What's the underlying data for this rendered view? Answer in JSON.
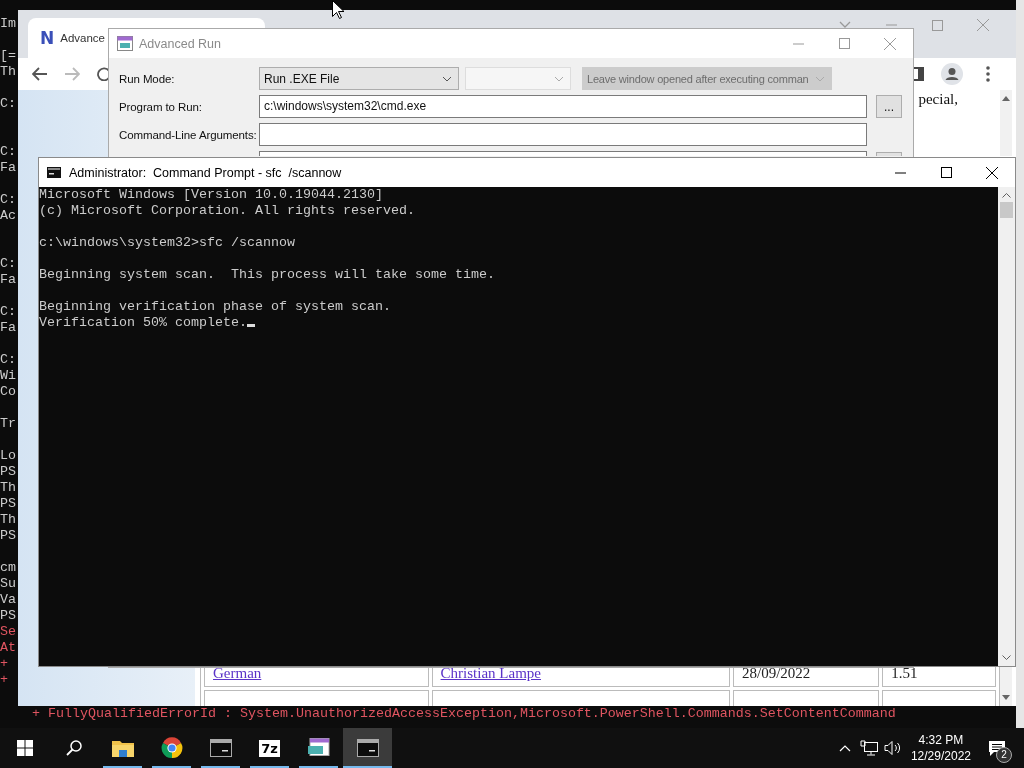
{
  "desktop_console": {
    "blocks": [
      {
        "error": false,
        "lines": [
          "Im"
        ]
      },
      {
        "error": false,
        "lines": [
          "[=",
          "Th"
        ]
      },
      {
        "error": false,
        "lines": [
          "C:"
        ]
      },
      {
        "error": false,
        "lines": [
          "C:",
          "Fa"
        ]
      },
      {
        "error": false,
        "lines": [
          "C:",
          "Ac"
        ]
      },
      {
        "error": false,
        "lines": [
          "C:",
          "Fa"
        ]
      },
      {
        "error": false,
        "lines": [
          "C:",
          "Fa"
        ]
      },
      {
        "error": false,
        "lines": [
          "C:",
          "Wi",
          "Co"
        ]
      },
      {
        "error": false,
        "lines": [
          "Tr"
        ]
      },
      {
        "error": false,
        "lines": [
          "Lo",
          "PS",
          "Th",
          "PS",
          "Th",
          "PS"
        ]
      },
      {
        "error": false,
        "lines": [
          "cm",
          "Su",
          "Va",
          "PS"
        ]
      },
      {
        "error": true,
        "lines": [
          "Se",
          "At",
          "+",
          "+"
        ]
      }
    ],
    "bottom_line": "+ FullyQualifiedErrorId : System.UnauthorizedAccessException,Microsoft.PowerShell.Commands.SetContentCommand"
  },
  "browser": {
    "tab": {
      "logo": "N",
      "title": "Advance"
    },
    "page_text": "pecial,",
    "table_rows": [
      [
        {
          "text": "German",
          "link": true
        },
        {
          "text": "Christian Lampe",
          "link": true
        },
        {
          "text": "28/09/2022",
          "link": false
        },
        {
          "text": "1.51",
          "link": false
        }
      ]
    ]
  },
  "advanced_run": {
    "title": "Advanced Run",
    "rows": [
      {
        "label": "Run Mode:",
        "controls": [
          {
            "kind": "select",
            "value": "Run .EXE File",
            "disabled": false
          },
          {
            "kind": "select",
            "disabled": true
          },
          {
            "kind": "select",
            "value": "Leave window opened after executing comman",
            "disabled": true
          }
        ]
      },
      {
        "label": "Program to Run:",
        "controls": [
          {
            "kind": "input",
            "value": "c:\\windows\\system32\\cmd.exe"
          },
          {
            "kind": "button",
            "text": "..."
          }
        ]
      },
      {
        "label": "Command-Line Arguments:",
        "controls": [
          {
            "kind": "input"
          }
        ]
      },
      {
        "controls": [
          {
            "kind": "input"
          },
          {
            "kind": "button"
          }
        ]
      }
    ]
  },
  "command_prompt": {
    "title": "Administrator:  Command Prompt - sfc  /scannow",
    "cursor": true,
    "blocks": [
      {
        "lines": [
          "Microsoft Windows [Version 10.0.19044.2130]",
          "(c) Microsoft Corporation. All rights reserved."
        ]
      },
      {
        "lines": [
          "c:\\windows\\system32>sfc /scannow"
        ]
      },
      {
        "lines": [
          "Beginning system scan.  This process will take some time."
        ]
      },
      {
        "lines": [
          "Beginning verification phase of system scan.",
          "Verification 50% complete."
        ]
      }
    ]
  },
  "taskbar": {
    "items": [
      {
        "kind": "start",
        "running": false,
        "selected": false
      },
      {
        "kind": "search",
        "running": false,
        "selected": false
      },
      {
        "kind": "folder",
        "running": true,
        "selected": false
      },
      {
        "kind": "browser",
        "running": true,
        "selected": false
      },
      {
        "kind": "terminal",
        "running": true,
        "selected": false
      },
      {
        "kind": "archive",
        "label": "7z",
        "running": true,
        "selected": false
      },
      {
        "kind": "runner",
        "running": true,
        "selected": false
      },
      {
        "kind": "terminal",
        "running": true,
        "selected": true
      }
    ],
    "time": "4:32 PM",
    "date": "12/29/2022",
    "notifications": "2"
  }
}
